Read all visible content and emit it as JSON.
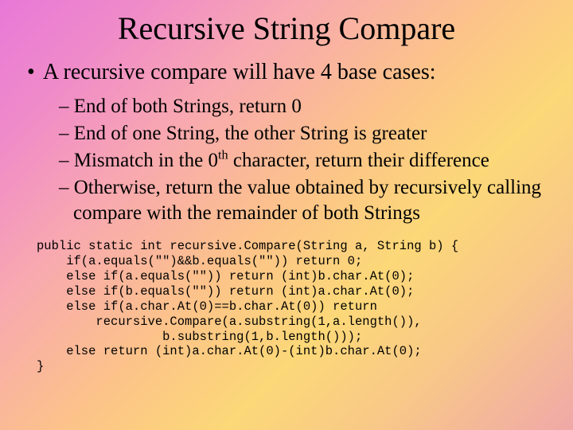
{
  "title": "Recursive String Compare",
  "main": {
    "bullet_glyph": "•",
    "text": "A recursive compare will have 4 base cases:"
  },
  "sub": {
    "dash_glyph": "–",
    "items": [
      "End of both Strings, return 0",
      "End of one String, the other String is greater",
      "Mismatch in the 0<sup>th</sup> character, return their difference",
      "Otherwise, return the value obtained by recursively calling compare with the remainder of both Strings"
    ]
  },
  "code": "public static int recursive.Compare(String a, String b) {\n    if(a.equals(\"\")&&b.equals(\"\")) return 0;\n    else if(a.equals(\"\")) return (int)b.char.At(0);\n    else if(b.equals(\"\")) return (int)a.char.At(0);\n    else if(a.char.At(0)==b.char.At(0)) return\n        recursive.Compare(a.substring(1,a.length()),\n                 b.substring(1,b.length()));\n    else return (int)a.char.At(0)-(int)b.char.At(0);\n}"
}
